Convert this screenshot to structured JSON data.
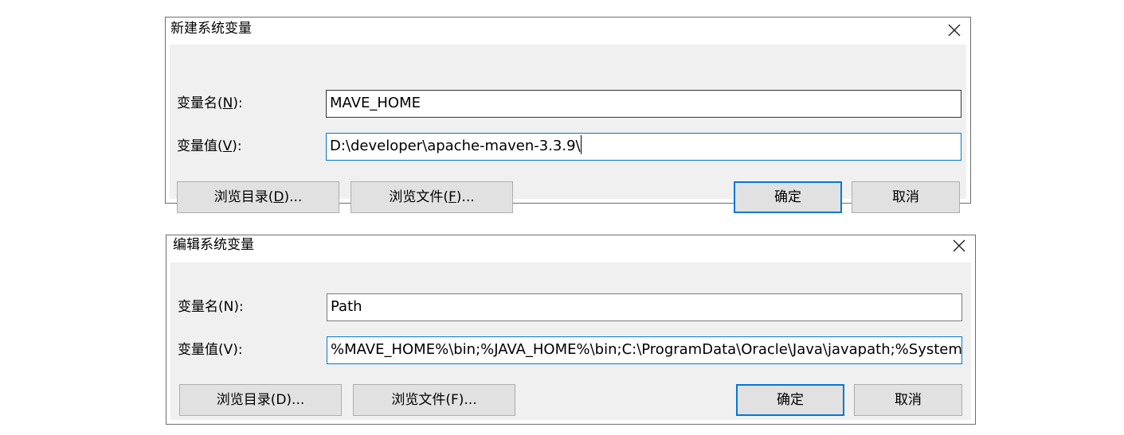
{
  "dialogs": [
    {
      "title": "新建系统变量",
      "name_label": {
        "text": "变量名(",
        "mnemonic": "N",
        "suffix": "):"
      },
      "name_value": "MAVE_HOME",
      "value_label": {
        "text": "变量值(",
        "mnemonic": "V",
        "suffix": "):"
      },
      "value_value": "D:\\developer\\apache-maven-3.3.9\\",
      "browse_dir": {
        "text": "浏览目录(",
        "mnemonic": "D",
        "suffix": ")..."
      },
      "browse_file": {
        "text": "浏览文件(",
        "mnemonic": "F",
        "suffix": ")..."
      },
      "ok": "确定",
      "cancel": "取消"
    },
    {
      "title": "编辑系统变量",
      "name_label": "变量名(N):",
      "name_value": "Path",
      "value_label": "变量值(V):",
      "value_value": "%MAVE_HOME%\\bin;%JAVA_HOME%\\bin;C:\\ProgramData\\Oracle\\Java\\javapath;%SystemR",
      "browse_dir": "浏览目录(D)...",
      "browse_file": "浏览文件(F)...",
      "ok": "确定",
      "cancel": "取消"
    }
  ],
  "icons": {
    "close": "close-icon"
  },
  "colors": {
    "focus": "#0078d7",
    "body": "#f0f0f0",
    "button": "#e1e1e1"
  }
}
